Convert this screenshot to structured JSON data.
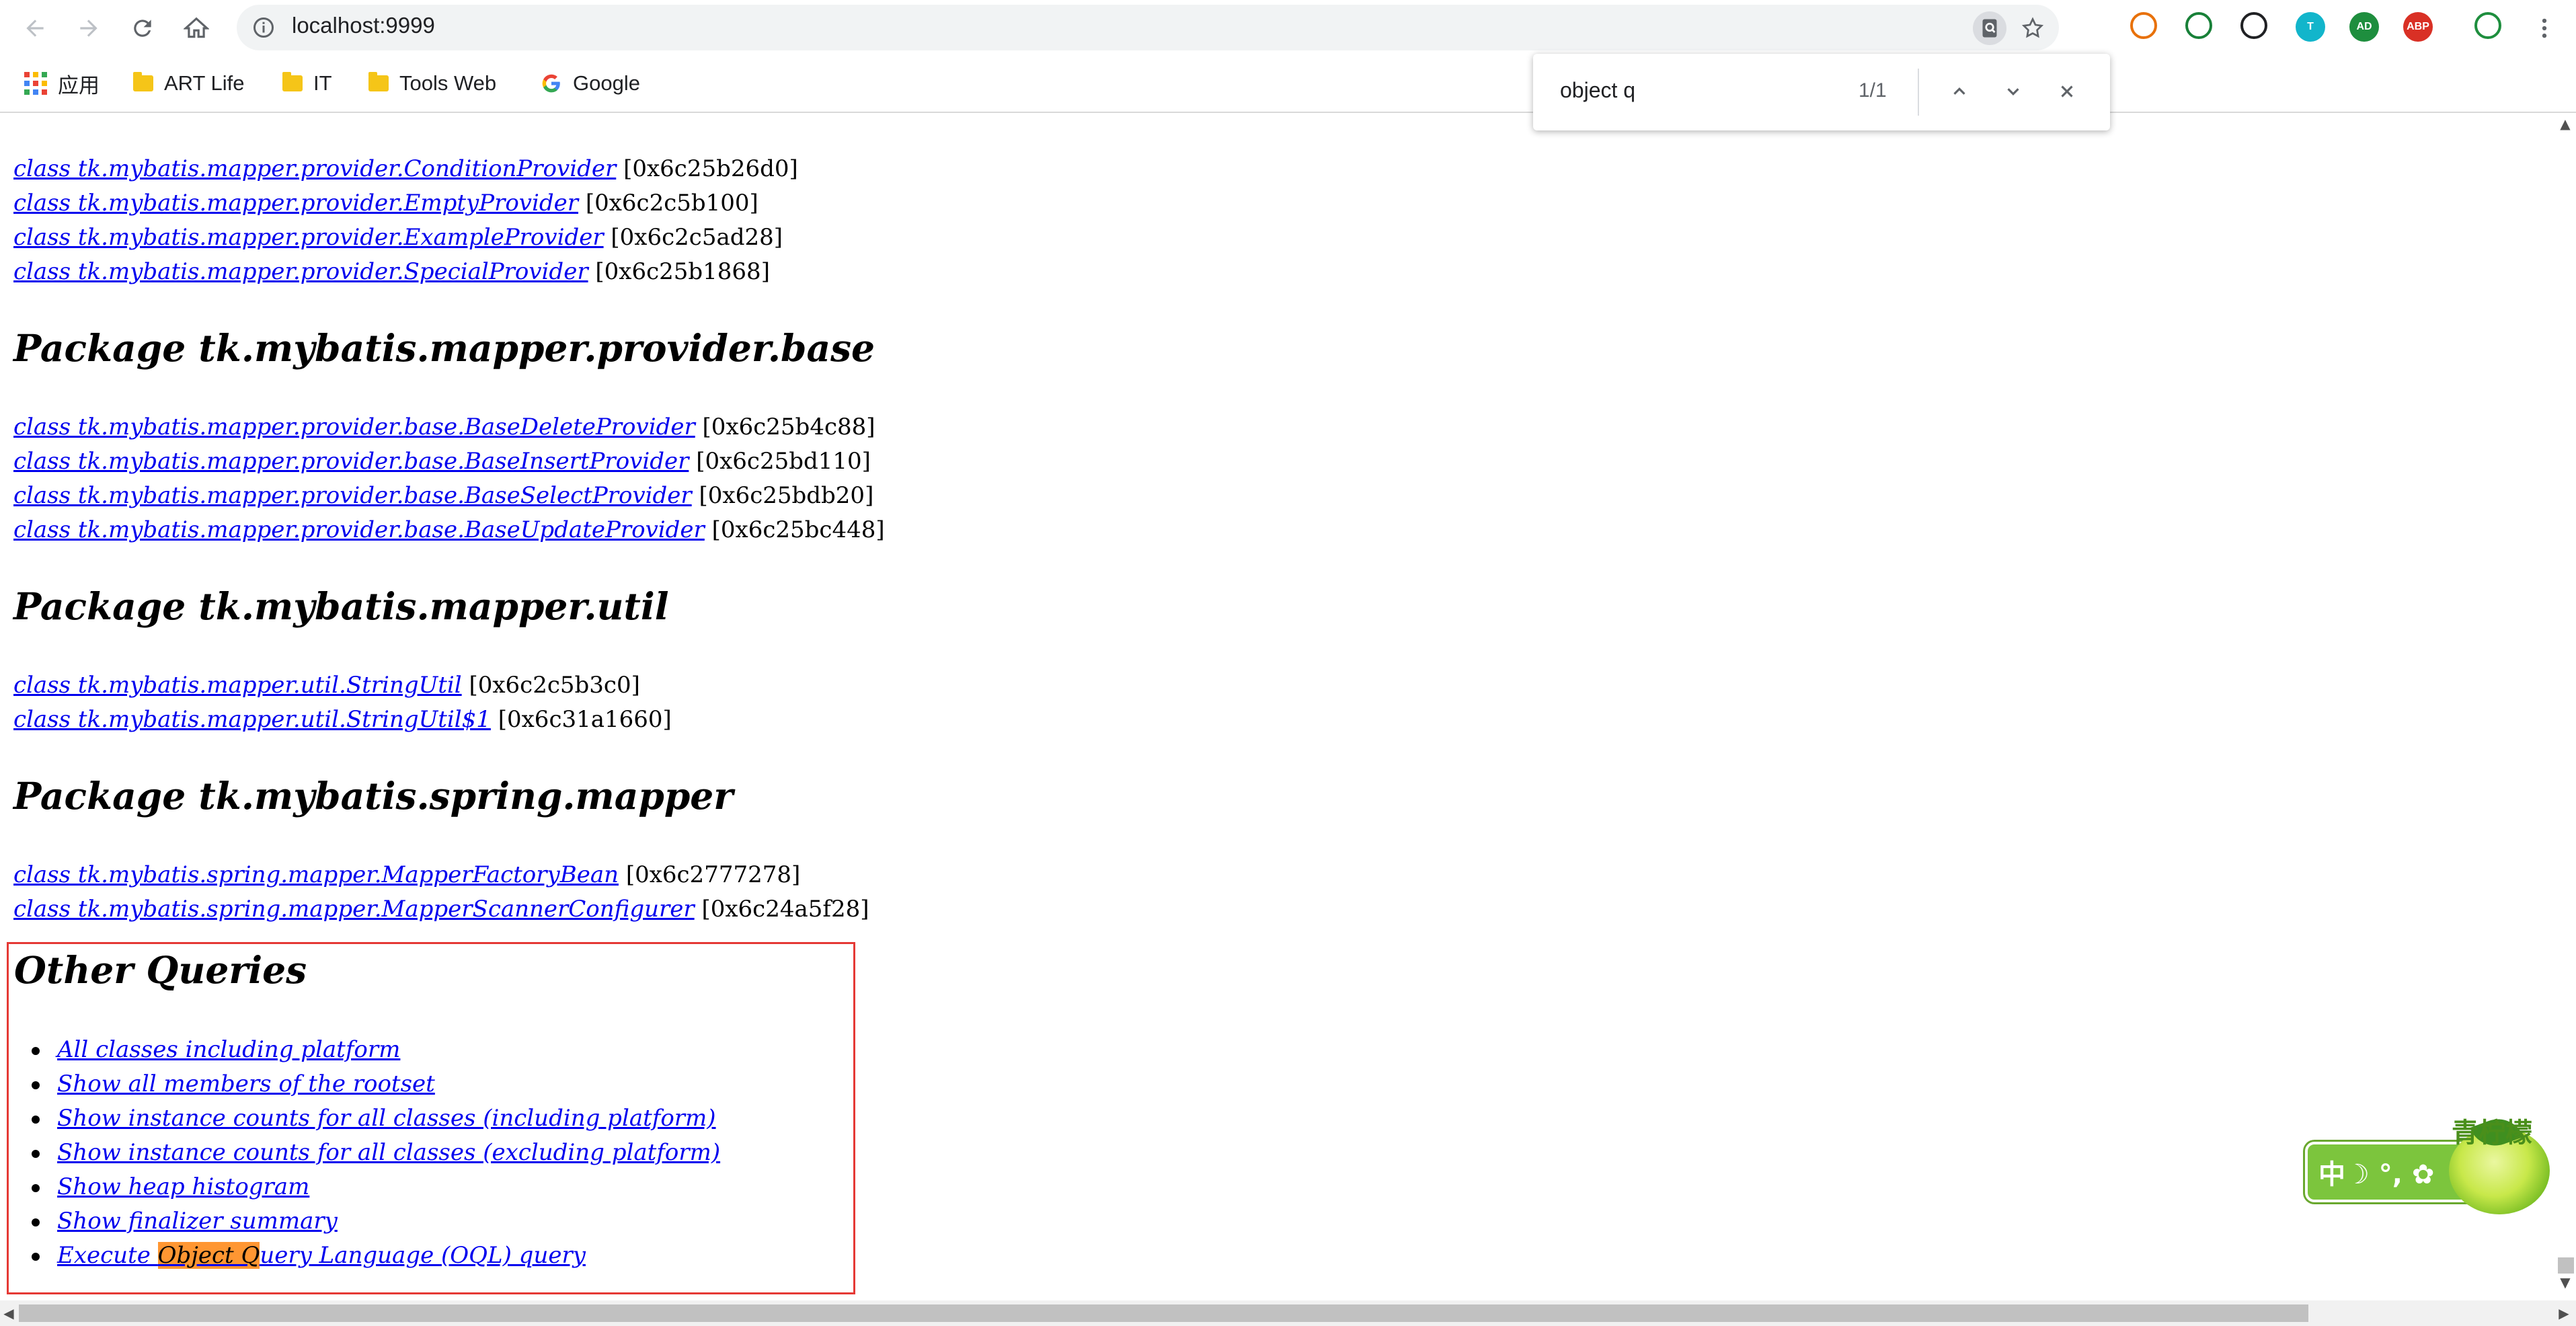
{
  "browser": {
    "url": "localhost:9999",
    "bookmarks": [
      {
        "label": "应用",
        "icon": "apps-grid-icon"
      },
      {
        "label": "ART Life",
        "icon": "folder-icon"
      },
      {
        "label": "IT",
        "icon": "folder-icon"
      },
      {
        "label": "Tools Web",
        "icon": "folder-icon"
      },
      {
        "label": "Google",
        "icon": "google-icon"
      }
    ],
    "extensions": [
      {
        "name": "network-extension-icon",
        "color": "#e8710a",
        "text": ""
      },
      {
        "name": "flag-extension-icon",
        "color": "#188038",
        "text": ""
      },
      {
        "name": "clock-extension-icon",
        "color": "#202124",
        "text": ""
      },
      {
        "name": "translate-extension-icon",
        "color": "#12b5cb",
        "text": "T"
      },
      {
        "name": "adguard-extension-icon",
        "color": "#1e8e3e",
        "text": "AD"
      },
      {
        "name": "adblock-plus-extension-icon",
        "color": "#d93025",
        "text": "ABP"
      },
      {
        "name": "shield-extension-icon",
        "color": "#1e8e3e",
        "text": ""
      }
    ]
  },
  "find_bar": {
    "query": "object q",
    "count": "1/1"
  },
  "content": {
    "top_rows": [
      {
        "link": "class tk.mybatis.mapper.provider.ConditionProvider",
        "addr": "[0x6c25b26d0]"
      },
      {
        "link": "class tk.mybatis.mapper.provider.EmptyProvider",
        "addr": "[0x6c2c5b100]"
      },
      {
        "link": "class tk.mybatis.mapper.provider.ExampleProvider",
        "addr": "[0x6c2c5ad28]"
      },
      {
        "link": "class tk.mybatis.mapper.provider.SpecialProvider",
        "addr": "[0x6c25b1868]"
      }
    ],
    "packages": [
      {
        "title": "Package tk.mybatis.mapper.provider.base",
        "rows": [
          {
            "link": "class tk.mybatis.mapper.provider.base.BaseDeleteProvider",
            "addr": "[0x6c25b4c88]"
          },
          {
            "link": "class tk.mybatis.mapper.provider.base.BaseInsertProvider",
            "addr": "[0x6c25bd110]"
          },
          {
            "link": "class tk.mybatis.mapper.provider.base.BaseSelectProvider",
            "addr": "[0x6c25bdb20]"
          },
          {
            "link": "class tk.mybatis.mapper.provider.base.BaseUpdateProvider",
            "addr": "[0x6c25bc448]"
          }
        ]
      },
      {
        "title": "Package tk.mybatis.mapper.util",
        "rows": [
          {
            "link": "class tk.mybatis.mapper.util.StringUtil",
            "addr": "[0x6c2c5b3c0]"
          },
          {
            "link": "class tk.mybatis.mapper.util.StringUtil$1",
            "addr": "[0x6c31a1660]"
          }
        ]
      },
      {
        "title": "Package tk.mybatis.spring.mapper",
        "rows": [
          {
            "link": "class tk.mybatis.spring.mapper.MapperFactoryBean",
            "addr": "[0x6c2777278]"
          },
          {
            "link": "class tk.mybatis.spring.mapper.MapperScannerConfigurer",
            "addr": "[0x6c24a5f28]"
          }
        ]
      }
    ],
    "other_queries": {
      "title": "Other Queries",
      "items": [
        "All classes including platform",
        "Show all members of the rootset",
        "Show instance counts for all classes (including platform)",
        "Show instance counts for all classes (excluding platform)",
        "Show heap histogram",
        "Show finalizer summary"
      ],
      "last_item": {
        "before": "Execute ",
        "highlight_1": "Object Q",
        "after_highlight": "uery Language (OQL) query"
      }
    }
  },
  "ime": {
    "brand": "青柠檬",
    "bar_text": "中☽ °, ✿"
  }
}
